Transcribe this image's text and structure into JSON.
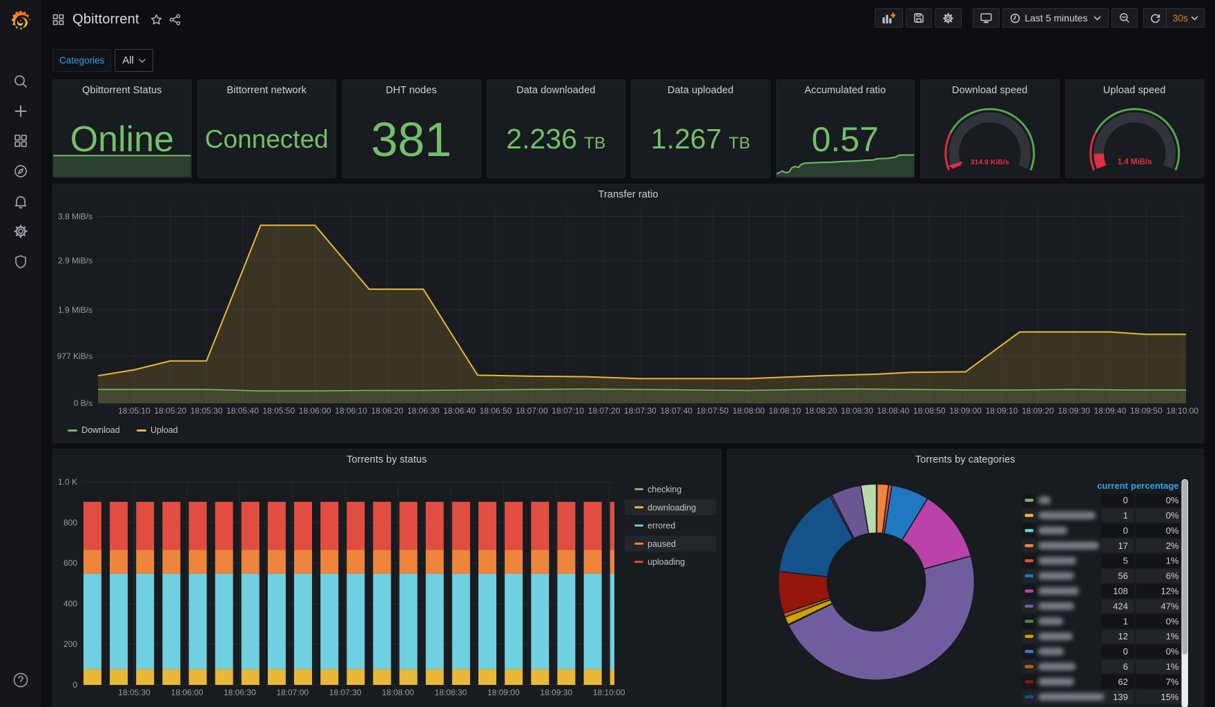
{
  "colors": {
    "page_background": "#0d0e12",
    "sidebar_background": "#15161c",
    "panel_background": "#181b1f",
    "text_primary": "#d8d9da",
    "text_secondary": "#9d9da6",
    "stat_green": "#73BF69",
    "accent_blue": "#33a2e5",
    "refresh_orange": "#eb7b18",
    "gauge_red": "#e02f44",
    "gauge_green": "#56a64b"
  },
  "sidebar_icons": [
    "grafana-logo",
    "search",
    "create-plus",
    "dashboards",
    "explore-compass",
    "alerting-bell",
    "configuration-gear",
    "admin-shield",
    "help"
  ],
  "topnav": {
    "title": "Qbittorrent",
    "icons_left": [
      "dashboard-grid",
      "star",
      "share"
    ],
    "icons_right": [
      "add-panel",
      "save-dashboard",
      "dashboard-settings",
      "tv-mode",
      "clock",
      "chevron-down",
      "zoom-out",
      "refresh"
    ],
    "time_range": "Last 5 minutes",
    "refresh_interval": "30s"
  },
  "submenu": {
    "variable_label": "Categories",
    "variable_value": "All"
  },
  "stats": [
    {
      "title": "Qbittorrent Status",
      "value": "Online",
      "sparkline": {
        "color": "#73BF69",
        "fill_opacity": 0.22,
        "points": [
          [
            0,
            0.97
          ],
          [
            1,
            0.97
          ]
        ]
      }
    },
    {
      "title": "Bittorrent network",
      "value": "Connected"
    },
    {
      "title": "DHT nodes",
      "value": "381"
    },
    {
      "title": "Data downloaded",
      "value": "2.236",
      "unit": "TB"
    },
    {
      "title": "Data uploaded",
      "value": "1.267",
      "unit": "TB"
    },
    {
      "title": "Accumulated ratio",
      "value": "0.57",
      "sparkline": {
        "color": "#73BF69",
        "fill_opacity": 0.22,
        "points": [
          [
            0,
            0.11
          ],
          [
            0.042,
            0.24
          ],
          [
            0.067,
            0.16
          ],
          [
            0.091,
            0.19
          ],
          [
            0.108,
            0.38
          ],
          [
            0.13,
            0.45
          ],
          [
            0.161,
            0.42
          ],
          [
            0.175,
            0.54
          ],
          [
            0.203,
            0.61
          ],
          [
            0.295,
            0.64
          ],
          [
            0.393,
            0.66
          ],
          [
            0.491,
            0.7
          ],
          [
            0.589,
            0.72
          ],
          [
            0.645,
            0.75
          ],
          [
            0.701,
            0.76
          ],
          [
            0.722,
            0.81
          ],
          [
            0.746,
            0.83
          ],
          [
            0.806,
            0.84
          ],
          [
            0.862,
            0.9
          ],
          [
            0.89,
            0.99
          ],
          [
            0.925,
            1.0
          ],
          [
            1,
            1.0
          ]
        ]
      }
    },
    {
      "title": "Download speed",
      "value": "314.9 KiB/s",
      "gauge": {
        "fraction": 0.0205,
        "threshold_fraction": 0.224,
        "marker": true,
        "value_color": "#e02f44",
        "ok_color": "#56a64b",
        "track_color": "#31343b"
      }
    },
    {
      "title": "Upload speed",
      "value": "1.4 MiB/s",
      "gauge": {
        "fraction": 0.097,
        "threshold_fraction": 0.224,
        "marker": false,
        "value_color": "#e02f44",
        "ok_color": "#56a64b",
        "track_color": "#31343b"
      }
    }
  ],
  "chart_data": [
    {
      "type": "area",
      "title": "Transfer ratio",
      "ylabel": "",
      "xlabel": "",
      "x_range_s": [
        0,
        301
      ],
      "y_max_kib": 4129,
      "grid": true,
      "legend_position": "bottom-left",
      "y_ticks": [
        {
          "v": 0,
          "label": "0 B/s"
        },
        {
          "v": 977,
          "label": "977 KiB/s"
        },
        {
          "v": 1945.6,
          "label": "1.9 MiB/s"
        },
        {
          "v": 2969.6,
          "label": "2.9 MiB/s"
        },
        {
          "v": 3891.2,
          "label": "3.8 MiB/s"
        }
      ],
      "x_ticks": [
        {
          "t": 10,
          "label": "18:05:10"
        },
        {
          "t": 20,
          "label": "18:05:20"
        },
        {
          "t": 30,
          "label": "18:05:30"
        },
        {
          "t": 40,
          "label": "18:05:40"
        },
        {
          "t": 50,
          "label": "18:05:50"
        },
        {
          "t": 60,
          "label": "18:06:00"
        },
        {
          "t": 70,
          "label": "18:06:10"
        },
        {
          "t": 80,
          "label": "18:06:20"
        },
        {
          "t": 90,
          "label": "18:06:30"
        },
        {
          "t": 100,
          "label": "18:06:40"
        },
        {
          "t": 110,
          "label": "18:06:50"
        },
        {
          "t": 120,
          "label": "18:07:00"
        },
        {
          "t": 130,
          "label": "18:07:10"
        },
        {
          "t": 140,
          "label": "18:07:20"
        },
        {
          "t": 150,
          "label": "18:07:30"
        },
        {
          "t": 160,
          "label": "18:07:40"
        },
        {
          "t": 170,
          "label": "18:07:50"
        },
        {
          "t": 180,
          "label": "18:08:00"
        },
        {
          "t": 190,
          "label": "18:08:10"
        },
        {
          "t": 200,
          "label": "18:08:20"
        },
        {
          "t": 210,
          "label": "18:08:30"
        },
        {
          "t": 220,
          "label": "18:08:40"
        },
        {
          "t": 230,
          "label": "18:08:50"
        },
        {
          "t": 240,
          "label": "18:09:00"
        },
        {
          "t": 250,
          "label": "18:09:10"
        },
        {
          "t": 260,
          "label": "18:09:20"
        },
        {
          "t": 270,
          "label": "18:09:30"
        },
        {
          "t": 280,
          "label": "18:09:40"
        },
        {
          "t": 290,
          "label": "18:09:50"
        },
        {
          "t": 300,
          "label": "18:10:00"
        }
      ],
      "series": [
        {
          "name": "Upload",
          "color": "#EAB839",
          "width": 2,
          "fill_opacity": 0.16,
          "points_t_kib": [
            [
              0,
              573
            ],
            [
              10,
              696
            ],
            [
              20,
              881
            ],
            [
              30,
              881
            ],
            [
              45,
              3707
            ],
            [
              60,
              3707
            ],
            [
              75,
              2375
            ],
            [
              90,
              2375
            ],
            [
              105,
              584
            ],
            [
              120,
              563
            ],
            [
              135,
              553
            ],
            [
              150,
              512
            ],
            [
              165,
              512
            ],
            [
              180,
              512
            ],
            [
              190,
              543
            ],
            [
              200,
              573
            ],
            [
              215,
              604
            ],
            [
              225,
              645
            ],
            [
              240,
              655
            ],
            [
              255,
              1485
            ],
            [
              270,
              1485
            ],
            [
              280,
              1485
            ],
            [
              290,
              1434
            ],
            [
              301,
              1434
            ]
          ]
        },
        {
          "name": "Download",
          "color": "#7EB26D",
          "width": 1.6,
          "fill_opacity": 0.16,
          "points_t_kib": [
            [
              0,
              287
            ],
            [
              15,
              287
            ],
            [
              30,
              287
            ],
            [
              45,
              256
            ],
            [
              60,
              256
            ],
            [
              75,
              266
            ],
            [
              90,
              266
            ],
            [
              105,
              276
            ],
            [
              120,
              287
            ],
            [
              135,
              297
            ],
            [
              150,
              287
            ],
            [
              165,
              276
            ],
            [
              180,
              266
            ],
            [
              195,
              287
            ],
            [
              210,
              297
            ],
            [
              225,
              287
            ],
            [
              240,
              276
            ],
            [
              255,
              276
            ],
            [
              270,
              287
            ],
            [
              285,
              276
            ],
            [
              301,
              276
            ]
          ]
        }
      ]
    },
    {
      "type": "bar",
      "title": "Torrents by status",
      "stacked": true,
      "bar_count": 20,
      "grid": true,
      "legend_position": "right",
      "legend": [
        {
          "label": "checking",
          "color": "#7EB26D",
          "highlight": false
        },
        {
          "label": "downloading",
          "color": "#EAB839",
          "highlight": true
        },
        {
          "label": "errored",
          "color": "#6ED0E0",
          "highlight": false
        },
        {
          "label": "paused",
          "color": "#EF843C",
          "highlight": true
        },
        {
          "label": "uploading",
          "color": "#E24D42",
          "highlight": false
        }
      ],
      "stack_values": [
        {
          "name": "downloading",
          "value": 78,
          "color": "#EAB839"
        },
        {
          "name": "errored",
          "value": 470,
          "color": "#6ED0E0"
        },
        {
          "name": "paused",
          "value": 118,
          "color": "#EF843C"
        },
        {
          "name": "uploading",
          "value": 236,
          "color": "#E24D42"
        }
      ],
      "checking_value": 0,
      "ylim": [
        0,
        1000
      ],
      "y_ticks": [
        {
          "v": 0,
          "label": "0"
        },
        {
          "v": 200,
          "label": "200"
        },
        {
          "v": 400,
          "label": "400"
        },
        {
          "v": 600,
          "label": "600"
        },
        {
          "v": 800,
          "label": "800"
        },
        {
          "v": 1000,
          "label": "1.0 K"
        }
      ],
      "x_ticks": [
        "18:05:30",
        "18:06:00",
        "18:06:30",
        "18:07:00",
        "18:07:30",
        "18:08:00",
        "18:08:30",
        "18:09:00",
        "18:09:30",
        "18:10:00"
      ]
    },
    {
      "type": "pie",
      "title": "Torrents by categories",
      "donut": true,
      "slices": [
        {
          "value": 1,
          "color": "#EAB839"
        },
        {
          "value": 17,
          "color": "#EF843C"
        },
        {
          "value": 5,
          "color": "#E24D42"
        },
        {
          "value": 56,
          "color": "#1F78C1"
        },
        {
          "value": 108,
          "color": "#BA43A9"
        },
        {
          "value": 424,
          "color": "#705DA0"
        },
        {
          "value": 1,
          "color": "#508642"
        },
        {
          "value": 12,
          "color": "#CCA300"
        },
        {
          "value": 6,
          "color": "#C15C17"
        },
        {
          "value": 62,
          "color": "#96150A"
        },
        {
          "value": 139,
          "color": "#14528C"
        },
        {
          "value": 3,
          "color": "#8F2878"
        },
        {
          "value": 45,
          "color": "#6B5694"
        },
        {
          "value": 23,
          "color": "#B7DBAB"
        }
      ],
      "table": {
        "headers": [
          "current",
          "percentage"
        ],
        "header_color": "#33A2E5",
        "rows": [
          {
            "swatch": "#7EB26D",
            "name_redacted_w": 18,
            "current": "0",
            "percentage": "0%"
          },
          {
            "swatch": "#EAB839",
            "name_redacted_w": 83,
            "current": "1",
            "percentage": "0%"
          },
          {
            "swatch": "#6ED0E0",
            "name_redacted_w": 42,
            "current": "0",
            "percentage": "0%"
          },
          {
            "swatch": "#EF843C",
            "name_redacted_w": 88,
            "current": "17",
            "percentage": "2%"
          },
          {
            "swatch": "#E24D42",
            "name_redacted_w": 55,
            "current": "5",
            "percentage": "1%"
          },
          {
            "swatch": "#1F78C1",
            "name_redacted_w": 52,
            "current": "56",
            "percentage": "6%"
          },
          {
            "swatch": "#BA43A9",
            "name_redacted_w": 59,
            "current": "108",
            "percentage": "12%"
          },
          {
            "swatch": "#705DA0",
            "name_redacted_w": 52,
            "current": "424",
            "percentage": "47%"
          },
          {
            "swatch": "#508642",
            "name_redacted_w": 36,
            "current": "1",
            "percentage": "0%"
          },
          {
            "swatch": "#CCA300",
            "name_redacted_w": 50,
            "current": "12",
            "percentage": "1%"
          },
          {
            "swatch": "#447EBC",
            "name_redacted_w": 37,
            "current": "0",
            "percentage": "0%"
          },
          {
            "swatch": "#C15C17",
            "name_redacted_w": 54,
            "current": "6",
            "percentage": "1%"
          },
          {
            "swatch": "#96150A",
            "name_redacted_w": 52,
            "current": "62",
            "percentage": "7%"
          },
          {
            "swatch": "#14528C",
            "name_redacted_w": 95,
            "current": "139",
            "percentage": "15%"
          }
        ]
      }
    }
  ]
}
